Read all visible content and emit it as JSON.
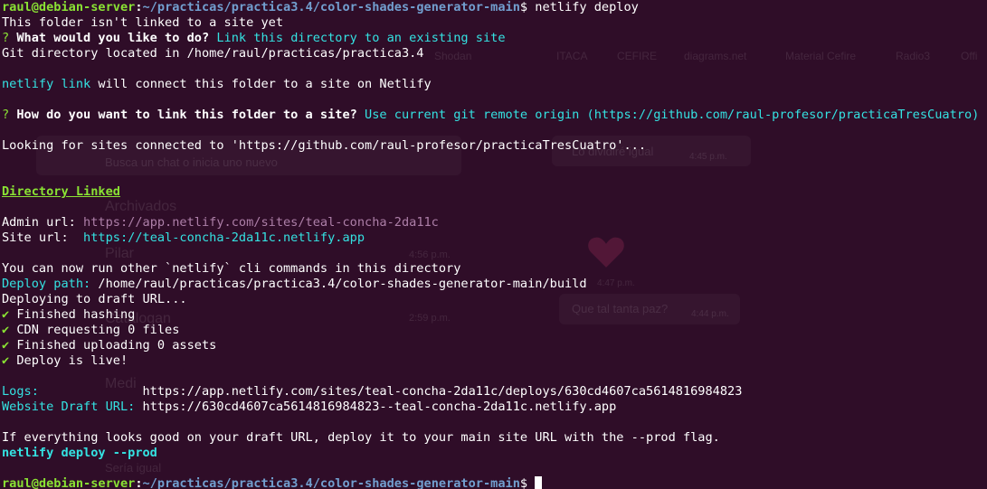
{
  "colors": {
    "background": "#2f0d28",
    "text": "#ffffff",
    "prompt_user": "#8ae234",
    "prompt_path": "#729fcf",
    "info_cyan": "#34e2e2",
    "url_magenta": "#ad7fa8",
    "check_green": "#8ae234"
  },
  "terminal": {
    "prompt_user": "raul@debian-server",
    "prompt_sep": ":",
    "prompt_path": "~/practicas/practica3.4/color-shades-generator-main",
    "prompt_dollar": "$",
    "command": " netlify deploy",
    "l1": "This folder isn't linked to a site yet",
    "q1_mark": "?",
    "q1_text": " What would you like to do?",
    "q1_answer": " Link this directory to an existing site",
    "l3": "Git directory located in /home/raul/practicas/practica3.4",
    "link_cmd": "netlify link",
    "link_text": " will connect this folder to a site on Netlify",
    "q2_mark": "?",
    "q2_text": " How do you want to link this folder to a site?",
    "q2_answer": " Use current git remote origin (https://github.com/raul-profesor/practicaTresCuatro)",
    "looking": "Looking for sites connected to 'https://github.com/raul-profesor/practicaTresCuatro'...",
    "dir_linked": "Directory Linked",
    "admin_label": "Admin url: ",
    "admin_url": "https://app.netlify.com/sites/teal-concha-2da11c",
    "site_label": "Site url:  ",
    "site_url": "https://teal-concha-2da11c.netlify.app",
    "now_run": "You can now run other `netlify` cli commands in this directory",
    "deploy_path_label": "Deploy path:",
    "deploy_path": " /home/raul/practicas/practica3.4/color-shades-generator-main/build",
    "deploying": "Deploying to draft URL...",
    "check_mark": "✔",
    "step1": " Finished hashing",
    "step2": " CDN requesting 0 files",
    "step3": " Finished uploading 0 assets",
    "step4": " Deploy is live!",
    "logs_label": "Logs:              ",
    "logs_url": "https://app.netlify.com/sites/teal-concha-2da11c/deploys/630cd4607ca5614816984823",
    "draft_label": "Website Draft URL:",
    "draft_url": " https://630cd4607ca5614816984823--teal-concha-2da11c.netlify.app",
    "if_everything": "If everything looks good on your draft URL, deploy it to your main site URL with the --prod flag.",
    "prod_cmd": "netlify deploy --prod",
    "final_prompt_user": "raul@debian-server",
    "final_prompt_sep": ":",
    "final_prompt_path": "~/practicas/practica3.4/color-shades-generator-main",
    "final_prompt_dollar": "$ "
  },
  "background_window": {
    "bookmarks": [
      "Shodan",
      "ITACA",
      "CEFIRE",
      "diagrams.net",
      "Material Cefire",
      "Radio3",
      "Offi"
    ],
    "search_placeholder": "Busca un chat o inicia uno nuevo",
    "chat_items": [
      "Archivados",
      "Pilar",
      "Catalogan",
      "Medi"
    ],
    "chat_times": [
      "4:56 p.m.",
      "2:59 p.m."
    ],
    "messages": [
      "Lo dividiré igual",
      "Que tal tanta paz?"
    ],
    "message_times": [
      "4:45 p.m.",
      "4:47 p.m.",
      "4:44 p.m."
    ],
    "extra": [
      "Sería igual"
    ]
  }
}
